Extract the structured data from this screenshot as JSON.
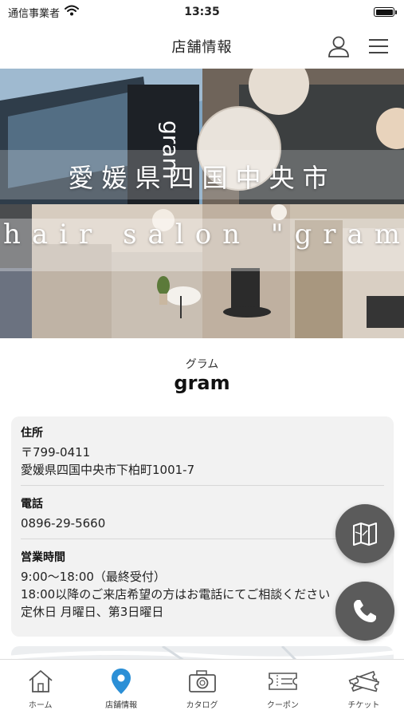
{
  "status_bar": {
    "carrier": "通信事業者",
    "time": "13:35",
    "battery_level": 1.0
  },
  "header": {
    "title": "店舗情報"
  },
  "hero": {
    "line1": "愛媛県四国中央市",
    "line2": "hair salon \"gram\""
  },
  "shop": {
    "kana": "グラム",
    "name": "gram"
  },
  "info": {
    "address": {
      "label": "住所",
      "postal": "〒799-0411",
      "line": "愛媛県四国中央市下柏町1001-7"
    },
    "phone": {
      "label": "電話",
      "number": "0896-29-5660"
    },
    "hours": {
      "label": "営業時間",
      "time": "9:00〜18:00（最終受付）",
      "note": "18:00以降のご来店希望の方はお電話にてご相談ください",
      "holiday": "定休日 月曜日、第3日曜日"
    }
  },
  "tabs": [
    {
      "label": "ホーム",
      "icon": "home-icon"
    },
    {
      "label": "店舗情報",
      "icon": "location-pin-icon"
    },
    {
      "label": "カタログ",
      "icon": "camera-icon"
    },
    {
      "label": "クーポン",
      "icon": "coupon-icon"
    },
    {
      "label": "チケット",
      "icon": "ticket-icon"
    }
  ],
  "colors": {
    "accent": "#2b8fd6",
    "fab": "#5b5b5b",
    "card": "#f2f2f2"
  }
}
